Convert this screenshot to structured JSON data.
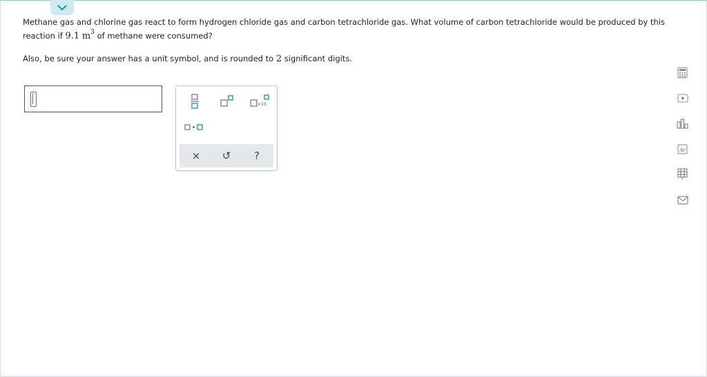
{
  "question": {
    "line1": "Methane gas and chlorine gas react to form hydrogen chloride gas and carbon tetrachloride gas. What volume of carbon tetrachloride would be produced by this",
    "line2_prefix": "reaction if",
    "value": "9.1",
    "unit": "m",
    "exponent": "3",
    "line2_suffix": "of methane were consumed?",
    "line3_prefix": "Also, be sure your answer has a unit symbol, and is rounded to",
    "sig_digits": "2",
    "line3_suffix": "significant digits."
  },
  "palette": {
    "sci_label": "×10",
    "clear_label": "×",
    "undo_label": "↺",
    "help_label": "?"
  },
  "sidebar": {
    "icons": [
      "calculator-icon",
      "video-icon",
      "chart-icon",
      "periodic-table-icon",
      "reference-icon",
      "mail-icon"
    ]
  },
  "colors": {
    "accent": "#7fc4d6",
    "tab": "#cfe8f2",
    "icon_gray": "#8a8f93",
    "cursor": "#5b6f9a"
  }
}
